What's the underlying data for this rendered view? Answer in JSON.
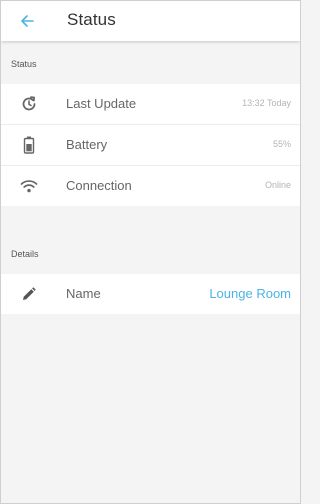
{
  "header": {
    "title": "Status",
    "back_icon": "arrow-left-icon",
    "accent_color": "#4bb3e6"
  },
  "sections": {
    "status": {
      "label": "Status",
      "rows": [
        {
          "icon": "update-refresh-icon",
          "label": "Last Update",
          "value": "13:32 Today"
        },
        {
          "icon": "battery-icon",
          "label": "Battery",
          "value": "55%"
        },
        {
          "icon": "wifi-icon",
          "label": "Connection",
          "value": "Online"
        }
      ]
    },
    "details": {
      "label": "Details",
      "rows": [
        {
          "icon": "pencil-icon",
          "label": "Name",
          "value": "Lounge Room"
        }
      ]
    }
  },
  "colors": {
    "background": "#f4f4f4",
    "surface": "#ffffff",
    "value_text": "#b4b4b4",
    "link": "#4bb3e6"
  }
}
